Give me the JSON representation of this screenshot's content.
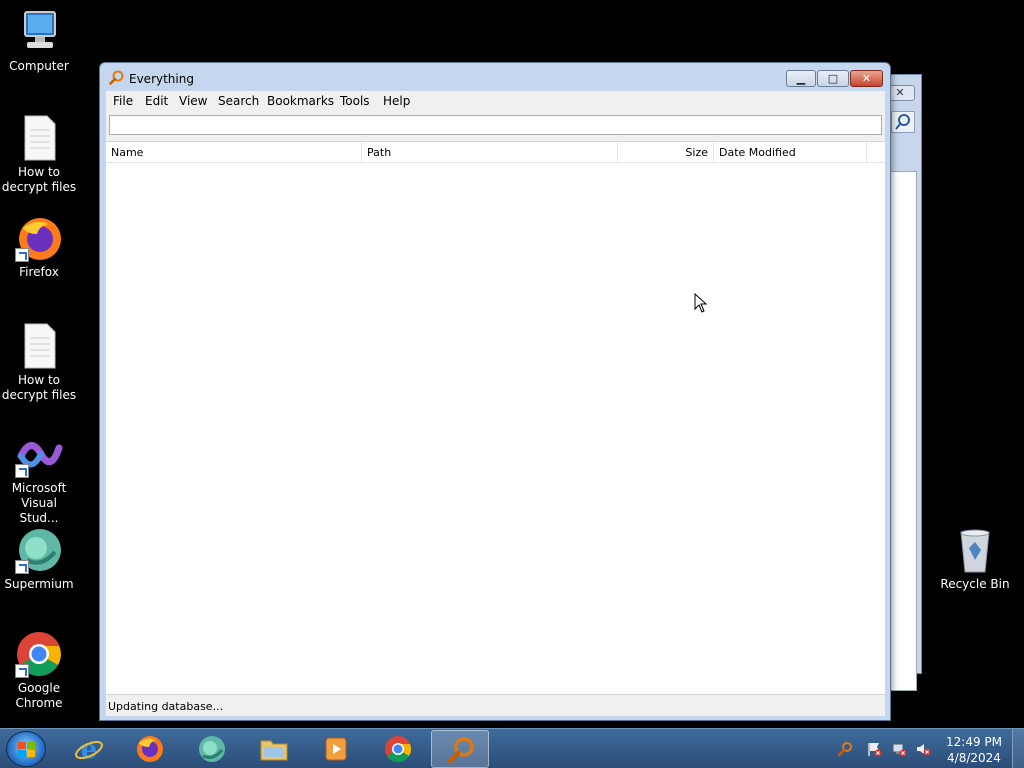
{
  "desktop": {
    "icons": [
      {
        "label": "Computer"
      },
      {
        "label": "How to decrypt files"
      },
      {
        "label": "Firefox"
      },
      {
        "label": "How to decrypt files"
      },
      {
        "label": "Microsoft Visual Stud..."
      },
      {
        "label": "Supermium"
      },
      {
        "label": "Google Chrome"
      },
      {
        "label": "Recycle Bin"
      }
    ]
  },
  "window": {
    "title": "Everything",
    "menu": [
      "File",
      "Edit",
      "View",
      "Search",
      "Bookmarks",
      "Tools",
      "Help"
    ],
    "search": {
      "value": "",
      "placeholder": ""
    },
    "columns": [
      "Name",
      "Path",
      "Size",
      "Date Modified"
    ],
    "status": "Updating database..."
  },
  "background_window": {
    "close_symbol": "✕"
  },
  "taskbar": {
    "apps": [
      "start-button",
      "internet-explorer",
      "firefox",
      "supermium",
      "file-explorer",
      "media-player",
      "chrome",
      "everything"
    ],
    "active_app": "everything",
    "clock_time": "12:49 PM",
    "clock_date": "4/8/2024"
  },
  "colors": {
    "titlebar": "#c5d7ee",
    "close": "#c7452b",
    "taskbar": "#2b4d78"
  }
}
